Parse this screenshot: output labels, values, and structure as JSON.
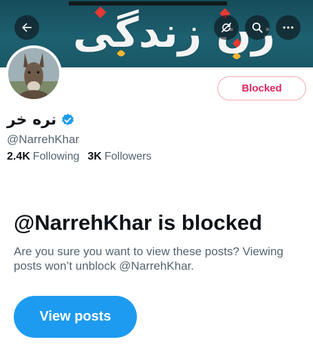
{
  "header": {
    "banner_text": "زن زندگی آزادی",
    "back_icon": "arrow-left-icon",
    "share_icon": "refresh-icon",
    "search_icon": "search-icon",
    "more_icon": "more-dots-icon"
  },
  "profile": {
    "display_name": "نره خر",
    "verified": true,
    "handle": "@NarrehKhar",
    "following_count": "2.4K",
    "following_label": "Following",
    "followers_count": "3K",
    "followers_label": "Followers",
    "blocked_label": "Blocked"
  },
  "blocked_notice": {
    "title": "@NarrehKhar is blocked",
    "description": "Are you sure you want to view these posts? Viewing posts won’t unblock @NarrehKhar.",
    "view_button_label": "View posts"
  },
  "colors": {
    "accent": "#1d9bf0",
    "blocked_red": "#e0245e",
    "banner_teal": "#1d6070"
  }
}
